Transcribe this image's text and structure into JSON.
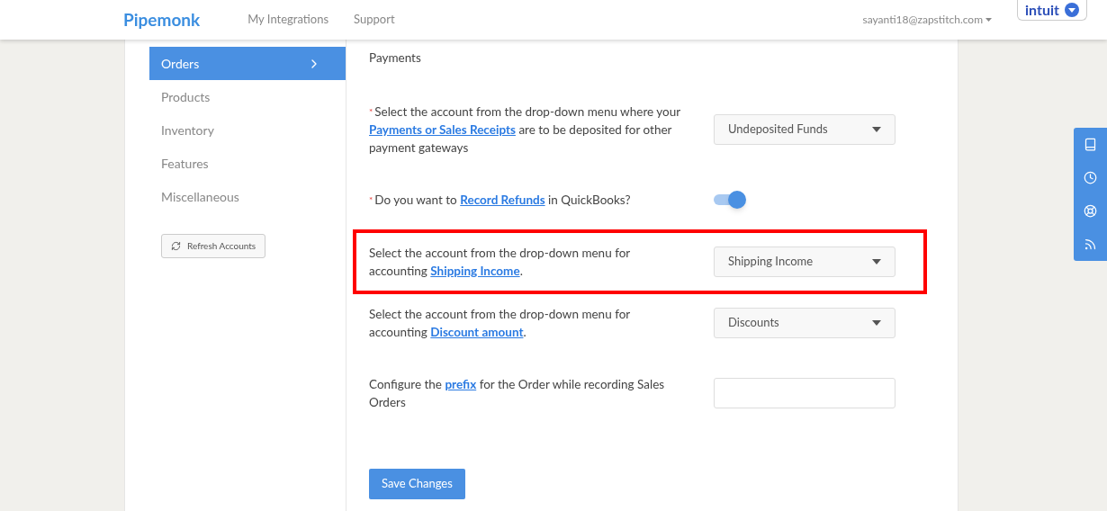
{
  "header": {
    "logo": "Pipemonk",
    "nav": [
      {
        "label": "My Integrations"
      },
      {
        "label": "Support"
      }
    ],
    "user_email": "sayanti18@zapstitch.com",
    "brand_button": "intuit"
  },
  "sidebar": {
    "items": [
      {
        "label": "Orders",
        "selected": true
      },
      {
        "label": "Products",
        "selected": false
      },
      {
        "label": "Inventory",
        "selected": false
      },
      {
        "label": "Features",
        "selected": false
      },
      {
        "label": "Miscellaneous",
        "selected": false
      }
    ],
    "refresh_button": "Refresh Accounts"
  },
  "settings": [
    {
      "kind": "text",
      "highlighted": false,
      "parts": [
        {
          "kind": "text",
          "text": "Payments"
        }
      ]
    },
    {
      "kind": "dropdown",
      "required_mark": "*",
      "highlighted": false,
      "parts": [
        {
          "kind": "text",
          "text": "Select the account from the drop-down menu where your "
        },
        {
          "kind": "link",
          "text": "Payments or Sales Receipts"
        },
        {
          "kind": "text",
          "text": " are to be deposited for other payment gateways"
        }
      ],
      "value": "Undeposited Funds"
    },
    {
      "kind": "toggle",
      "required_mark": "*",
      "highlighted": false,
      "parts": [
        {
          "kind": "text",
          "text": "Do you want to "
        },
        {
          "kind": "link",
          "text": "Record Refunds"
        },
        {
          "kind": "text",
          "text": " in QuickBooks?"
        }
      ],
      "on": true
    },
    {
      "kind": "dropdown",
      "highlighted": true,
      "parts": [
        {
          "kind": "text",
          "text": "Select the account from the drop-down menu for accounting "
        },
        {
          "kind": "link",
          "text": "Shipping Income"
        },
        {
          "kind": "text",
          "text": "."
        }
      ],
      "value": "Shipping Income"
    },
    {
      "kind": "dropdown",
      "highlighted": false,
      "parts": [
        {
          "kind": "text",
          "text": "Select the account from the drop-down menu for accounting "
        },
        {
          "kind": "link",
          "text": "Discount amount"
        },
        {
          "kind": "text",
          "text": "."
        }
      ],
      "value": "Discounts"
    },
    {
      "kind": "input",
      "highlighted": false,
      "parts": [
        {
          "kind": "text",
          "text": "Configure the "
        },
        {
          "kind": "link",
          "text": "prefix"
        },
        {
          "kind": "text",
          "text": " for the Order while recording Sales Orders"
        }
      ]
    }
  ],
  "save_button": "Save Changes"
}
